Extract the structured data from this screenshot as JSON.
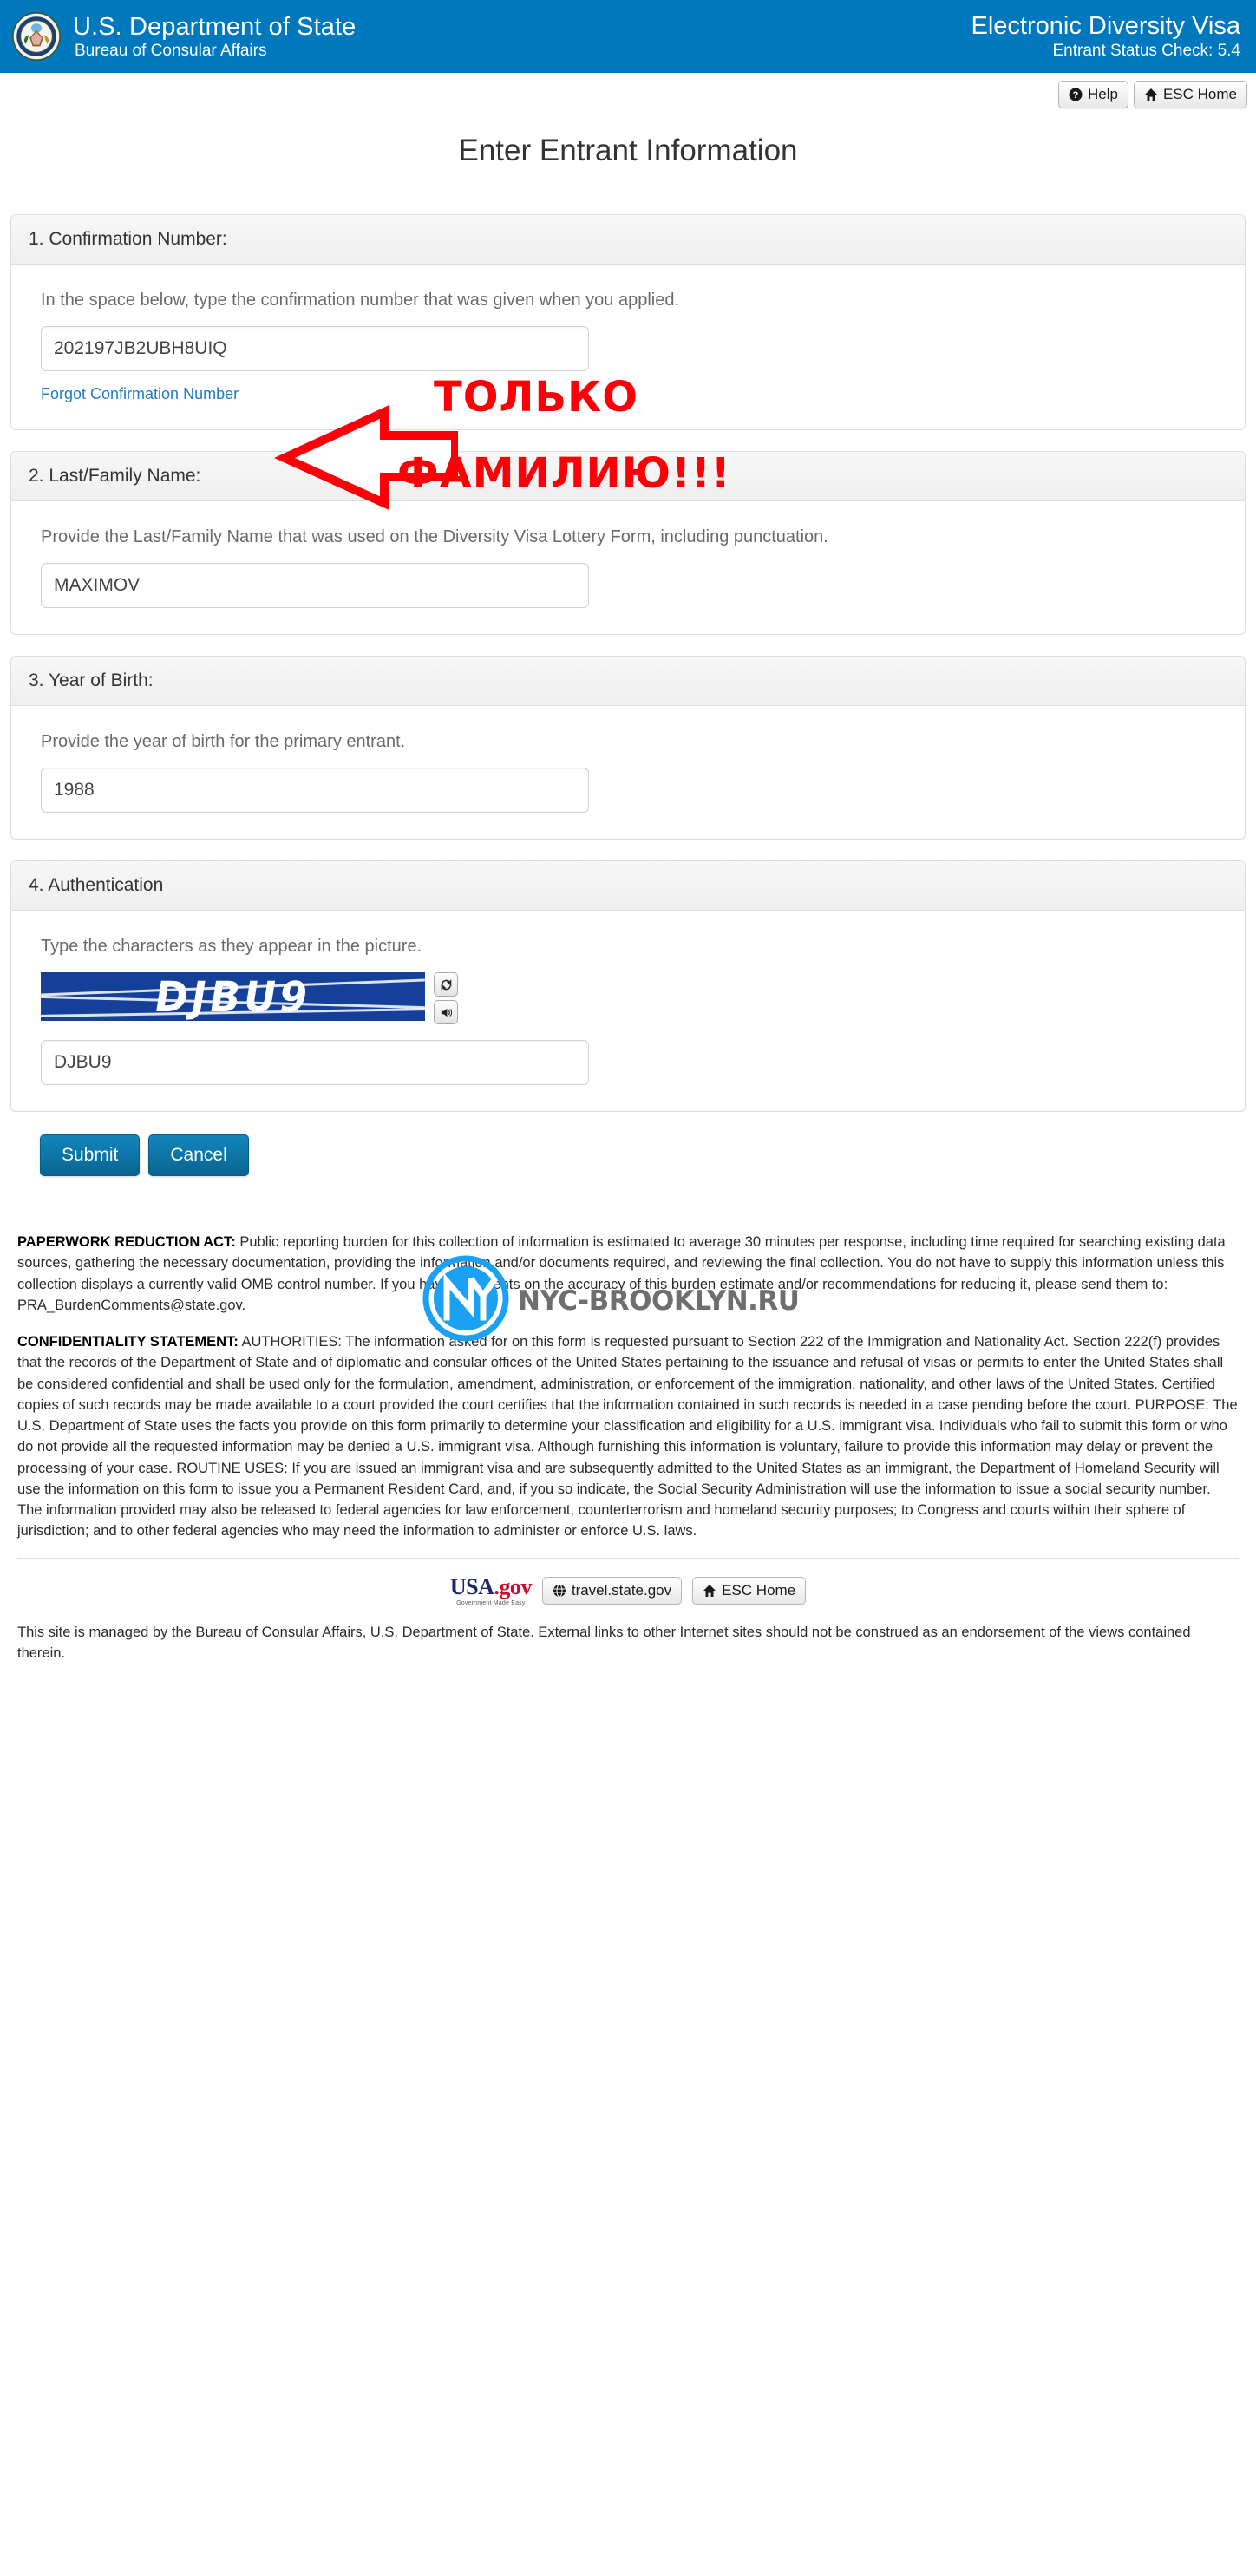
{
  "header": {
    "agency_name": "U.S. Department of State",
    "bureau_name": "Bureau of Consular Affairs",
    "app_name": "Electronic Diversity Visa",
    "app_version_line": "Entrant Status Check: 5.4",
    "brand_color": "#0078be",
    "seal_icon": "us-department-of-state-seal"
  },
  "utility": {
    "help_label": "Help",
    "help_icon": "question-circle-icon",
    "esc_home_label": "ESC Home",
    "home_icon": "home-icon"
  },
  "page": {
    "title": "Enter Entrant Information"
  },
  "sections": {
    "confirmation": {
      "heading": "1. Confirmation Number:",
      "instruction": "In the space below, type the confirmation number that was given when you applied.",
      "value": "202197JB2UBH8UIQ",
      "placeholder": "",
      "forgot_link": "Forgot Confirmation Number"
    },
    "last_name": {
      "heading": "2. Last/Family Name:",
      "instruction": "Provide the Last/Family Name that was used on the Diversity Visa Lottery Form, including punctuation.",
      "value": "MAXIMOV",
      "placeholder": ""
    },
    "year_of_birth": {
      "heading": "3. Year of Birth:",
      "instruction": "Provide the year of birth for the primary entrant.",
      "value": "1988",
      "placeholder": ""
    },
    "authentication": {
      "heading": "4. Authentication",
      "instruction": "Type the characters as they appear in the picture.",
      "captcha_text": "DJBU9",
      "captcha_bg_color": "#14409a",
      "refresh_icon": "refresh-icon",
      "audio_icon": "speaker-icon",
      "value": "DJBU9",
      "placeholder": ""
    }
  },
  "actions": {
    "submit_label": "Submit",
    "cancel_label": "Cancel",
    "button_color": "#0a648f"
  },
  "legal": {
    "paperwork_label": "PAPERWORK REDUCTION ACT:",
    "paperwork_text": " Public reporting burden for this collection of information is estimated to average 30 minutes per response, including time required for searching existing data sources, gathering the necessary documentation, providing the information and/or documents required, and reviewing the final collection. You do not have to supply this information unless this collection displays a currently valid OMB control number. If you have comments on the accuracy of this burden estimate and/or recommendations for reducing it, please send them to: PRA_BurdenComments@state.gov.",
    "confidentiality_label": "CONFIDENTIALITY STATEMENT:",
    "confidentiality_text": " AUTHORITIES: The information asked for on this form is requested pursuant to Section 222 of the Immigration and Nationality Act. Section 222(f) provides that the records of the Department of State and of diplomatic and consular offices of the United States pertaining to the issuance and refusal of visas or permits to enter the United States shall be considered confidential and shall be used only for the formulation, amendment, administration, or enforcement of the immigration, nationality, and other laws of the United States. Certified copies of such records may be made available to a court provided the court certifies that the information contained in such records is needed in a case pending before the court. PURPOSE: The U.S. Department of State uses the facts you provide on this form primarily to determine your classification and eligibility for a U.S. immigrant visa. Individuals who fail to submit this form or who do not provide all the requested information may be denied a U.S. immigrant visa. Although furnishing this information is voluntary, failure to provide this information may delay or prevent the processing of your case. ROUTINE USES: If you are issued an immigrant visa and are subsequently admitted to the United States as an immigrant, the Department of Homeland Security will use the information on this form to issue you a Permanent Resident Card, and, if you so indicate, the Social Security Administration will use the information to issue a social security number. The information provided may also be released to federal agencies for law enforcement, counterterrorism and homeland security purposes; to Congress and courts within their sphere of jurisdiction; and to other federal agencies who may need the information to administer or enforce U.S. laws."
  },
  "footer": {
    "usagov_word": "USA",
    "usagov_gov": ".gov",
    "usagov_tagline": "Government Made Easy",
    "travel_label": "travel.state.gov",
    "globe_icon": "globe-icon",
    "esc_home_label": "ESC Home",
    "home_icon": "home-icon",
    "note": "This site is managed by the Bureau of Consular Affairs, U.S. Department of State. External links to other Internet sites should not be construed as an endorsement of the views contained therein."
  },
  "annotation": {
    "arrow_icon": "left-arrow-annotation",
    "arrow_color": "#fb0007",
    "line1": "ТОЛЬКО",
    "line2": "ФАМИЛИЮ!!!"
  },
  "watermark": {
    "monogram": "NY",
    "site": "NYC-BROOKLYN.RU",
    "color": "#1ba1f2"
  }
}
